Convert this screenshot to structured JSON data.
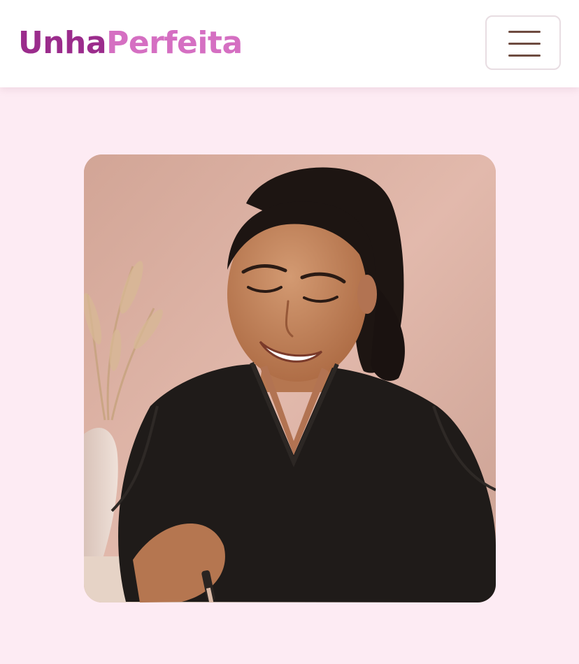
{
  "header": {
    "logo": {
      "part1": "Unha",
      "part2": "Perfeita"
    },
    "menu_icon": "hamburger-menu-icon"
  },
  "hero": {
    "image_subject": "manicurist-portrait"
  },
  "colors": {
    "page_background": "#fdebf3",
    "header_background": "#ffffff",
    "logo_primary": "#9b2c8c",
    "logo_secondary": "#d56fc2",
    "menu_lines": "#6e4b40"
  }
}
